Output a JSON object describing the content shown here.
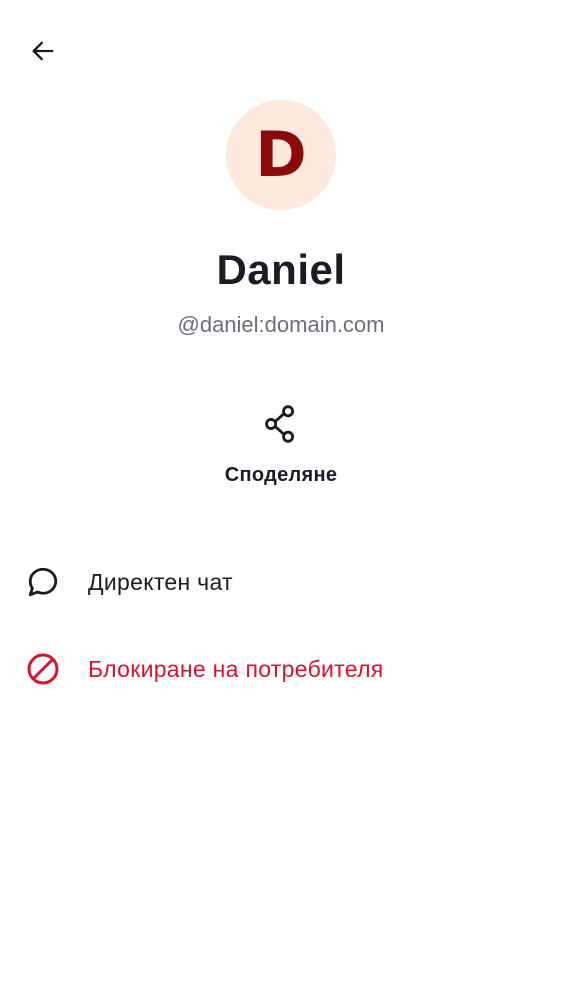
{
  "header": {
    "back_icon": "arrow-left-icon"
  },
  "profile": {
    "avatar_letter": "D",
    "display_name": "Daniel",
    "user_id": "@daniel:domain.com",
    "avatar_bg": "#fde9dd",
    "avatar_fg": "#8b0a0a"
  },
  "actions": {
    "share_icon": "share-icon",
    "share_label": "Споделяне"
  },
  "menu": {
    "items": [
      {
        "icon": "chat-bubble-icon",
        "label": "Директен чат",
        "color": "#1b1d22"
      },
      {
        "icon": "block-icon",
        "label": "Блокиране на потребителя",
        "color": "#d7142c"
      }
    ]
  }
}
